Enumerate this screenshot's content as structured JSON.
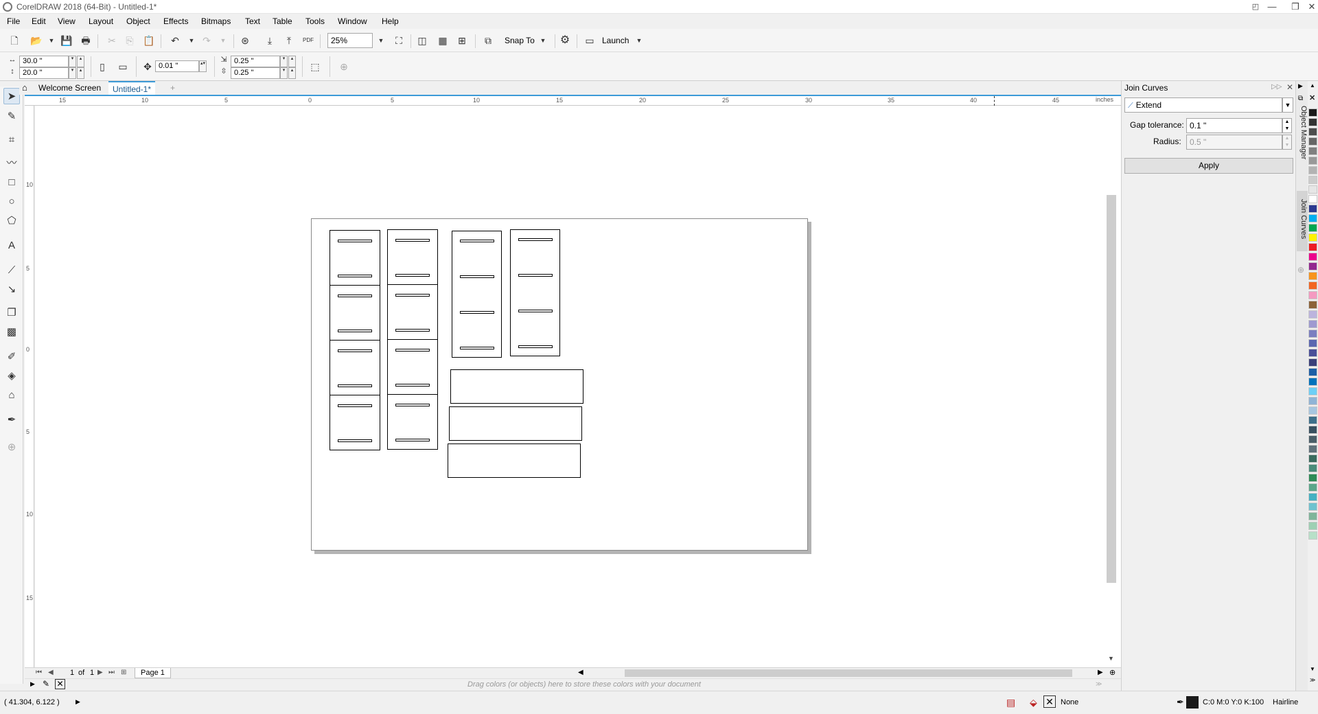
{
  "window": {
    "title": "CorelDRAW 2018 (64-Bit) - Untitled-1*",
    "min_glyph": "—",
    "max_glyph": "❐",
    "close_glyph": "✕"
  },
  "menu": [
    "File",
    "Edit",
    "View",
    "Layout",
    "Object",
    "Effects",
    "Bitmaps",
    "Text",
    "Table",
    "Tools",
    "Window",
    "Help"
  ],
  "toolbar": {
    "zoom": "25%",
    "snap_to": "Snap To",
    "launch": "Launch",
    "pdf": "PDF"
  },
  "property_bar": {
    "width": "30.0 \"",
    "height": "20.0 \"",
    "nudge": "0.01 \"",
    "dup_x": "0.25 \"",
    "dup_y": "0.25 \""
  },
  "tabs": {
    "welcome": "Welcome Screen",
    "document": "Untitled-1*",
    "add": "+"
  },
  "ruler": {
    "unit": "inches",
    "top_labels": [
      "15",
      "10",
      "5",
      "0",
      "5",
      "10",
      "15",
      "20",
      "25",
      "30",
      "35",
      "40",
      "45"
    ],
    "left_labels": [
      "10",
      "5",
      "0",
      "5",
      "10",
      "15"
    ]
  },
  "page_nav": {
    "current": "1",
    "of_label": "of",
    "total": "1",
    "page_tab": "Page 1"
  },
  "palette_hint": "Drag colors (or objects) here to store these colors with your document",
  "status": {
    "coords": "( 41.304, 6.122 )",
    "fill": "None",
    "outline_color": "C:0 M:0 Y:0 K:100",
    "outline_width": "Hairline"
  },
  "docker": {
    "title": "Join Curves",
    "mode": "Extend",
    "gap_label": "Gap tolerance:",
    "gap_value": "0.1 \"",
    "radius_label": "Radius:",
    "radius_value": "0.5 \"",
    "apply": "Apply",
    "tab_object_manager": "Object Manager",
    "tab_join_curves": "Join Curves"
  },
  "palette_colors": [
    "#1a1a1a",
    "#333333",
    "#4d4d4d",
    "#666666",
    "#808080",
    "#999999",
    "#b3b3b3",
    "#cccccc",
    "#e6e6e6",
    "#ffffff",
    "#2b3990",
    "#00aeef",
    "#00a651",
    "#fff200",
    "#ed1c24",
    "#ec008c",
    "#92278f",
    "#f7941d",
    "#f26522",
    "#f49ac1",
    "#8c6239",
    "#bcb4dd",
    "#9e9ad0",
    "#7b7fc0",
    "#5b67b0",
    "#4a4f98",
    "#3a3f7a",
    "#1d5fa6",
    "#0072bc",
    "#6dcff6",
    "#8fb4d6",
    "#a6c6e0",
    "#3d6f8a",
    "#385060",
    "#4a5e68",
    "#60717a",
    "#3a6b5e",
    "#4a8c7a",
    "#2e8b57",
    "#5aa68a",
    "#45b1c2",
    "#6fc2cf",
    "#7fb59a",
    "#9ed0b4",
    "#b8e0c8"
  ]
}
